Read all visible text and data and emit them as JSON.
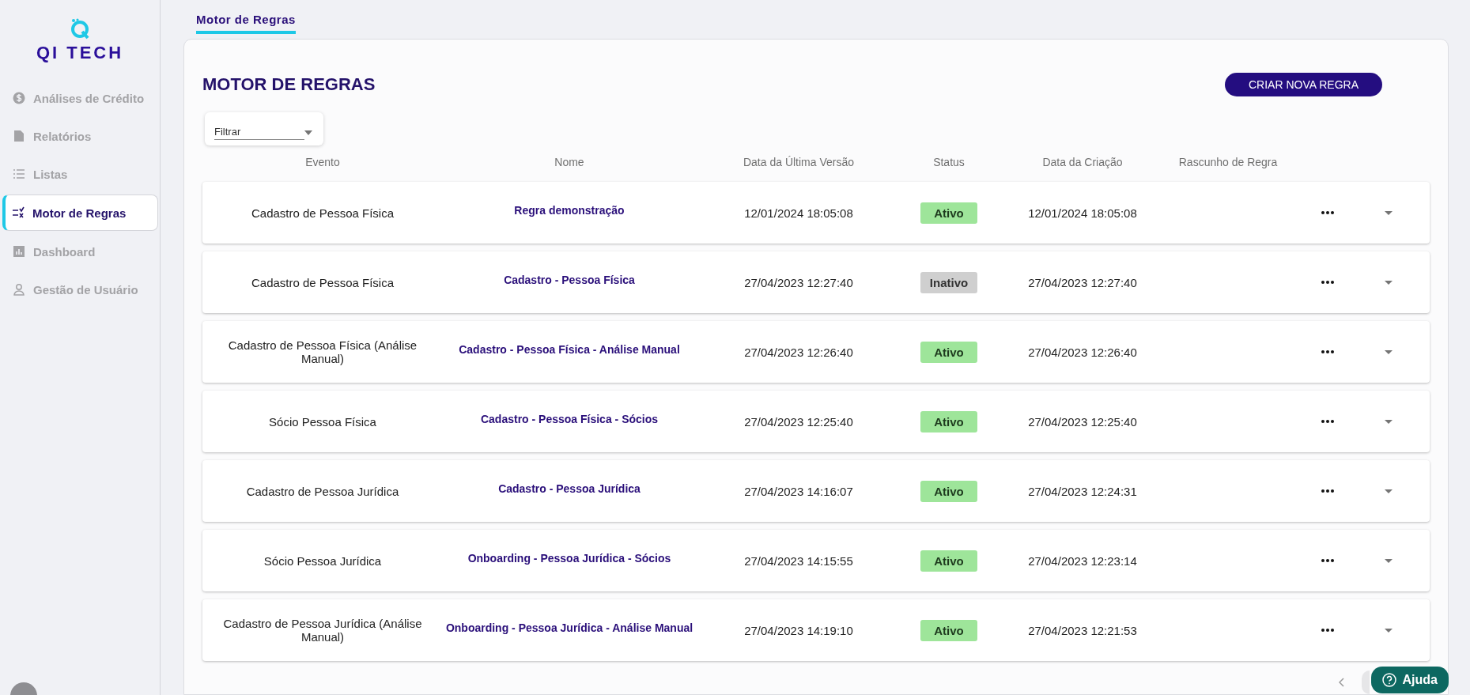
{
  "brand": {
    "name": "QI TECH"
  },
  "sidebar": {
    "items": [
      {
        "label": "Análises de Crédito",
        "selected": false
      },
      {
        "label": "Relatórios",
        "selected": false
      },
      {
        "label": "Listas",
        "selected": false
      },
      {
        "label": "Motor de Regras",
        "selected": true
      },
      {
        "label": "Dashboard",
        "selected": false
      },
      {
        "label": "Gestão de Usuário",
        "selected": false
      }
    ]
  },
  "tabs": [
    {
      "label": "Motor de Regras",
      "selected": true
    }
  ],
  "page": {
    "title": "MOTOR DE REGRAS",
    "create_button": "CRIAR NOVA REGRA",
    "filter": {
      "placeholder": "Filtrar"
    }
  },
  "table": {
    "columns": [
      "Evento",
      "Nome",
      "Data da Última Versão",
      "Status",
      "Data da Criação",
      "Rascunho de Regra"
    ],
    "rows": [
      {
        "event": "Cadastro de Pessoa Física",
        "name": "Regra demonstração",
        "last_version": "12/01/2024 18:05:08",
        "status": "Ativo",
        "active": true,
        "created": "12/01/2024 18:05:08"
      },
      {
        "event": "Cadastro de Pessoa Física",
        "name": "Cadastro - Pessoa Física",
        "last_version": "27/04/2023 12:27:40",
        "status": "Inativo",
        "active": false,
        "created": "27/04/2023 12:27:40"
      },
      {
        "event": "Cadastro de Pessoa Física (Análise Manual)",
        "name": "Cadastro - Pessoa Física - Análise Manual",
        "last_version": "27/04/2023 12:26:40",
        "status": "Ativo",
        "active": true,
        "created": "27/04/2023 12:26:40"
      },
      {
        "event": "Sócio Pessoa Física",
        "name": "Cadastro - Pessoa Física - Sócios",
        "last_version": "27/04/2023 12:25:40",
        "status": "Ativo",
        "active": true,
        "created": "27/04/2023 12:25:40"
      },
      {
        "event": "Cadastro de Pessoa Jurídica",
        "name": "Cadastro - Pessoa Jurídica",
        "last_version": "27/04/2023 14:16:07",
        "status": "Ativo",
        "active": true,
        "created": "27/04/2023 12:24:31"
      },
      {
        "event": "Sócio Pessoa Jurídica",
        "name": "Onboarding - Pessoa Jurídica - Sócios",
        "last_version": "27/04/2023 14:15:55",
        "status": "Ativo",
        "active": true,
        "created": "27/04/2023 12:23:14"
      },
      {
        "event": "Cadastro de Pessoa Jurídica (Análise Manual)",
        "name": "Onboarding - Pessoa Jurídica - Análise Manual",
        "last_version": "27/04/2023 14:19:10",
        "status": "Ativo",
        "active": true,
        "created": "27/04/2023 12:21:53"
      }
    ]
  },
  "help_button": "Ajuda"
}
